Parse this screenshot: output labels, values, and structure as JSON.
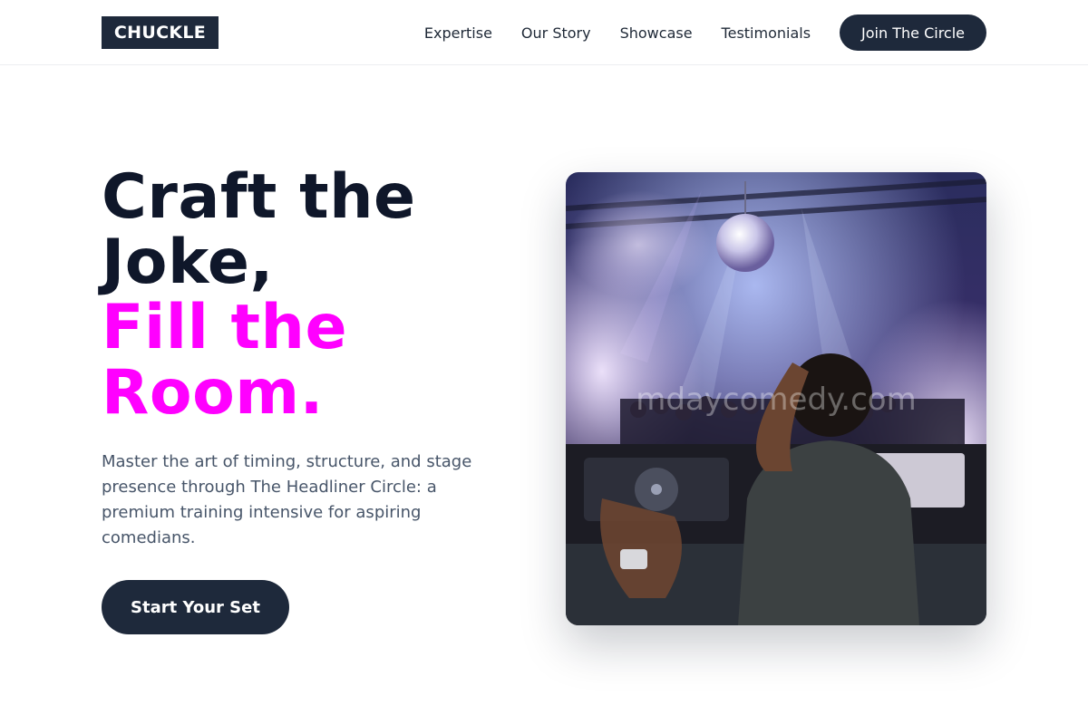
{
  "brand": {
    "logo_text": "CHUCKLE"
  },
  "nav": {
    "links": [
      {
        "label": "Expertise"
      },
      {
        "label": "Our Story"
      },
      {
        "label": "Showcase"
      },
      {
        "label": "Testimonials"
      }
    ],
    "cta_label": "Join The Circle"
  },
  "hero": {
    "headline_line1": "Craft the",
    "headline_line2": "Joke,",
    "headline_accent1": "Fill the",
    "headline_accent2": "Room.",
    "subtext": "Master the art of timing, structure, and stage presence through The Headliner Circle: a premium training intensive for aspiring comedians.",
    "cta_label": "Start Your Set",
    "image_watermark": "mdaycomedy.com"
  },
  "colors": {
    "primary_dark": "#1e293b",
    "headline": "#0f172a",
    "accent_magenta": "#ff00ff",
    "body_text": "#475569"
  }
}
